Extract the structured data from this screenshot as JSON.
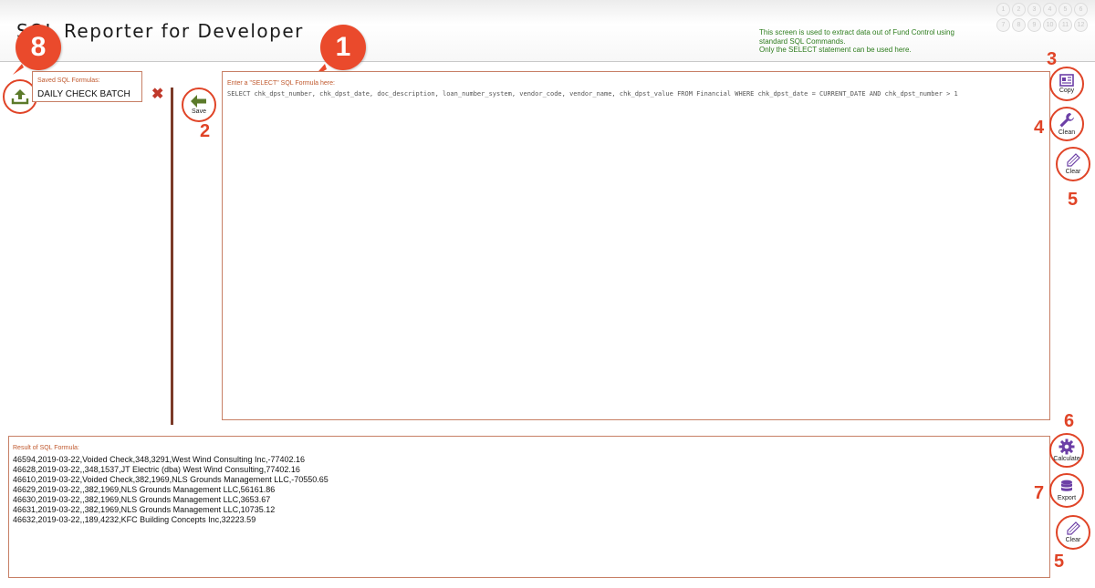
{
  "header": {
    "title": "SQL Reporter for Developer",
    "info_lines": [
      "This screen is used to extract data out of Fund Control using standard SQL Commands.",
      "Only the SELECT statement can be used here."
    ],
    "steps": [
      "1",
      "2",
      "3",
      "4",
      "5",
      "6",
      "7",
      "8",
      "9",
      "10",
      "11",
      "12"
    ]
  },
  "saved": {
    "label": "Saved SQL Formulas:",
    "value": "DAILY CHECK BATCH"
  },
  "sql": {
    "label": "Enter a \"SELECT\" SQL Formula here:",
    "value": "SELECT chk_dpst_number, chk_dpst_date, doc_description, loan_number_system, vendor_code, vendor_name, chk_dpst_value FROM Financial WHERE chk_dpst_date = CURRENT_DATE AND chk_dpst_number > 1"
  },
  "result": {
    "label": "Result of SQL Formula:",
    "rows": [
      "46594,2019-03-22,Voided Check,348,3291,West Wind Consulting Inc,-77402.16",
      "46628,2019-03-22,,348,1537,JT Electric (dba) West Wind Consulting,77402.16",
      "46610,2019-03-22,Voided Check,382,1969,NLS Grounds Management LLC,-70550.65",
      "46629,2019-03-22,,382,1969,NLS Grounds Management LLC,56161.86",
      "46630,2019-03-22,,382,1969,NLS Grounds Management LLC,3653.67",
      "46631,2019-03-22,,382,1969,NLS Grounds Management LLC,10735.12",
      "46632,2019-03-22,,189,4232,KFC Building Concepts Inc,32223.59"
    ]
  },
  "buttons": {
    "save": "Save",
    "copy": "Copy",
    "clean": "Clean",
    "clear": "Clear",
    "calculate": "Calculate",
    "export": "Export",
    "delete_glyph": "✖"
  },
  "callouts": {
    "bubble_1": "1",
    "bubble_8": "8",
    "n2": "2",
    "n3": "3",
    "n4": "4",
    "n5a": "5",
    "n6": "6",
    "n7": "7",
    "n5b": "5"
  },
  "colors": {
    "accent": "#e04427",
    "panel_border": "#c77f65",
    "info_text": "#2e7d1e",
    "icon_purple": "#6c3fa6",
    "icon_green": "#5b7a2a"
  },
  "icons": {
    "upload": "upload-icon",
    "save": "arrow-left-icon",
    "copy": "copy-icon",
    "clean": "wrench-icon",
    "clear": "eraser-icon",
    "calculate": "gear-icon",
    "export": "database-icon",
    "delete": "close-icon"
  }
}
